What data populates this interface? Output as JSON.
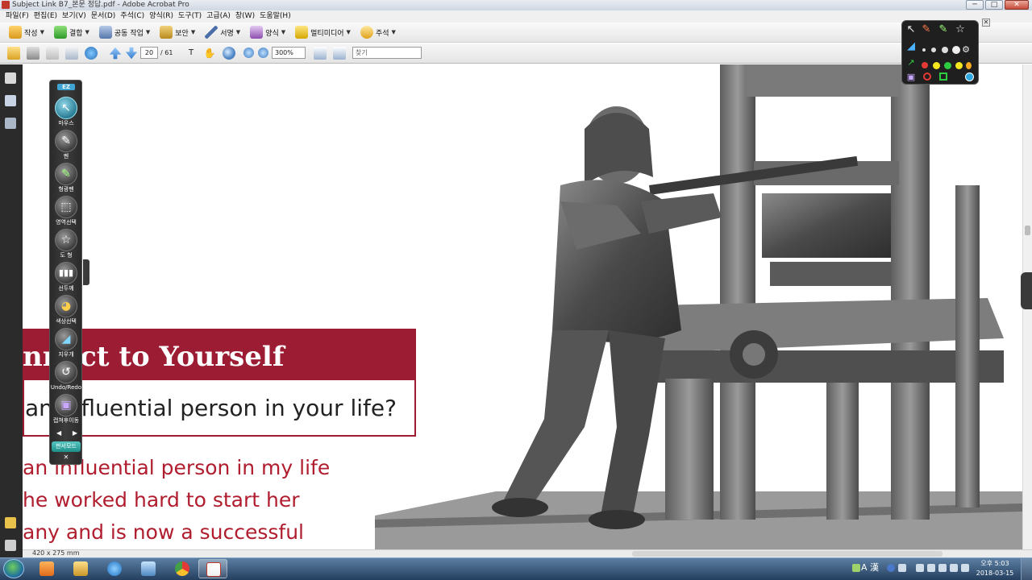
{
  "window": {
    "title": "Subject Link B7_본문 정답.pdf - Adobe Acrobat Pro",
    "minimize_glyph": "─",
    "maximize_glyph": "□",
    "close_glyph": "✕"
  },
  "menu": [
    "파일(F)",
    "편집(E)",
    "보기(V)",
    "문서(D)",
    "주석(C)",
    "양식(R)",
    "도구(T)",
    "고급(A)",
    "창(W)",
    "도움말(H)"
  ],
  "toolbar1": {
    "create": "작성",
    "combine": "결합",
    "collaborate": "공동 작업",
    "secure": "보안",
    "sign": "서명",
    "forms": "양식",
    "multimedia": "멀티미디어",
    "comment": "주석"
  },
  "toolbar2": {
    "page_current": "20",
    "page_total": "/ 61",
    "zoom": "300%",
    "find_placeholder": "찾기"
  },
  "document": {
    "banner_text": "nnect to Yourself",
    "question_text": "an influential person in your life?",
    "answer_lines": [
      " an influential person in my life",
      "he worked hard to start her",
      "any and is now a successful"
    ]
  },
  "status": {
    "page_size": "420 x 275 mm"
  },
  "pen_toolbar": {
    "logo": "EZ",
    "tools": [
      "마우스",
      "펜",
      "형광펜",
      "영역선택",
      "도 형",
      "선두께",
      "색상선택",
      "지우개",
      "Undo/Redo",
      "캡쳐후이동"
    ],
    "arrows_left": "◀",
    "arrows_right": "▶",
    "mode_button": "판서모드",
    "close": "✕"
  },
  "pen_palette": {
    "close": "✕",
    "colors": [
      "#e53935",
      "#f5e61d",
      "#2ecc40",
      "#ffffff",
      "#2fa8e0",
      "#d81b60"
    ]
  },
  "taskbar": {
    "ime": "A 漢",
    "time": "오후 5:03",
    "date": "2018-03-15"
  },
  "colors": {
    "banner": "#9b1c33",
    "answer_text": "#b01d2e",
    "palette_active": "#2a7d95"
  }
}
